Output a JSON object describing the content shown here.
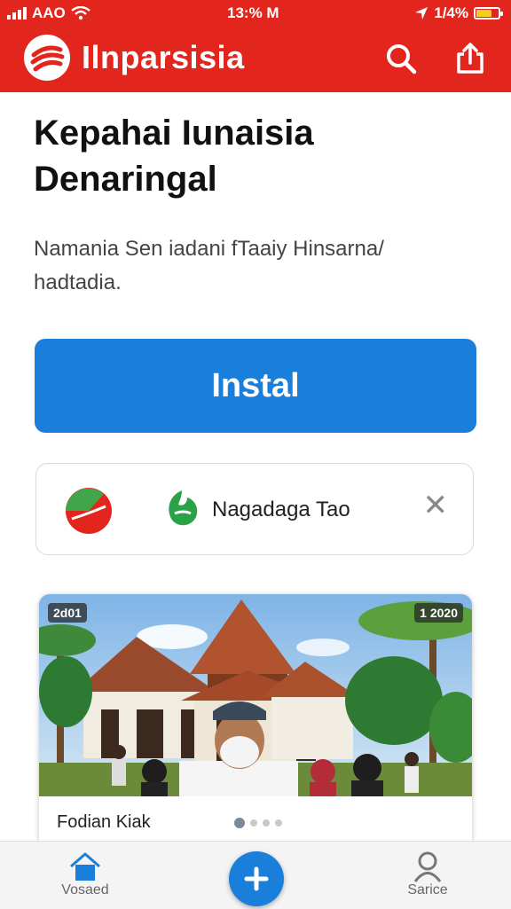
{
  "status_bar": {
    "carrier": "AAO",
    "time": "13:% M",
    "battery": "1/4%",
    "battery_level": 0.7,
    "battery_color": "#f3d11a"
  },
  "header": {
    "app_name": "Ilnparsisia",
    "brand_color": "#e2261d",
    "icons": [
      "search-icon",
      "share-icon"
    ]
  },
  "main": {
    "title": "Kepahai Iunaisia Denaringal",
    "description": "Namania Sen iadani fTaaiy Hinsarna/ hadtadia.",
    "install_label": "Instal",
    "accent_color": "#1a7fdb"
  },
  "banner": {
    "text": "Nagadaga Tao",
    "icons": [
      "app-logo-icon",
      "leaf-icon",
      "close-icon"
    ]
  },
  "news_card": {
    "badge_left": "2d01",
    "badge_right": "1 2020",
    "caption": "Fodian Kiak",
    "page_count": 4,
    "active_page": 1
  },
  "bottom_nav": {
    "home_label": "Vosaed",
    "profile_label": "Sarice",
    "icons": [
      "home-icon",
      "plus-icon",
      "person-icon"
    ]
  }
}
